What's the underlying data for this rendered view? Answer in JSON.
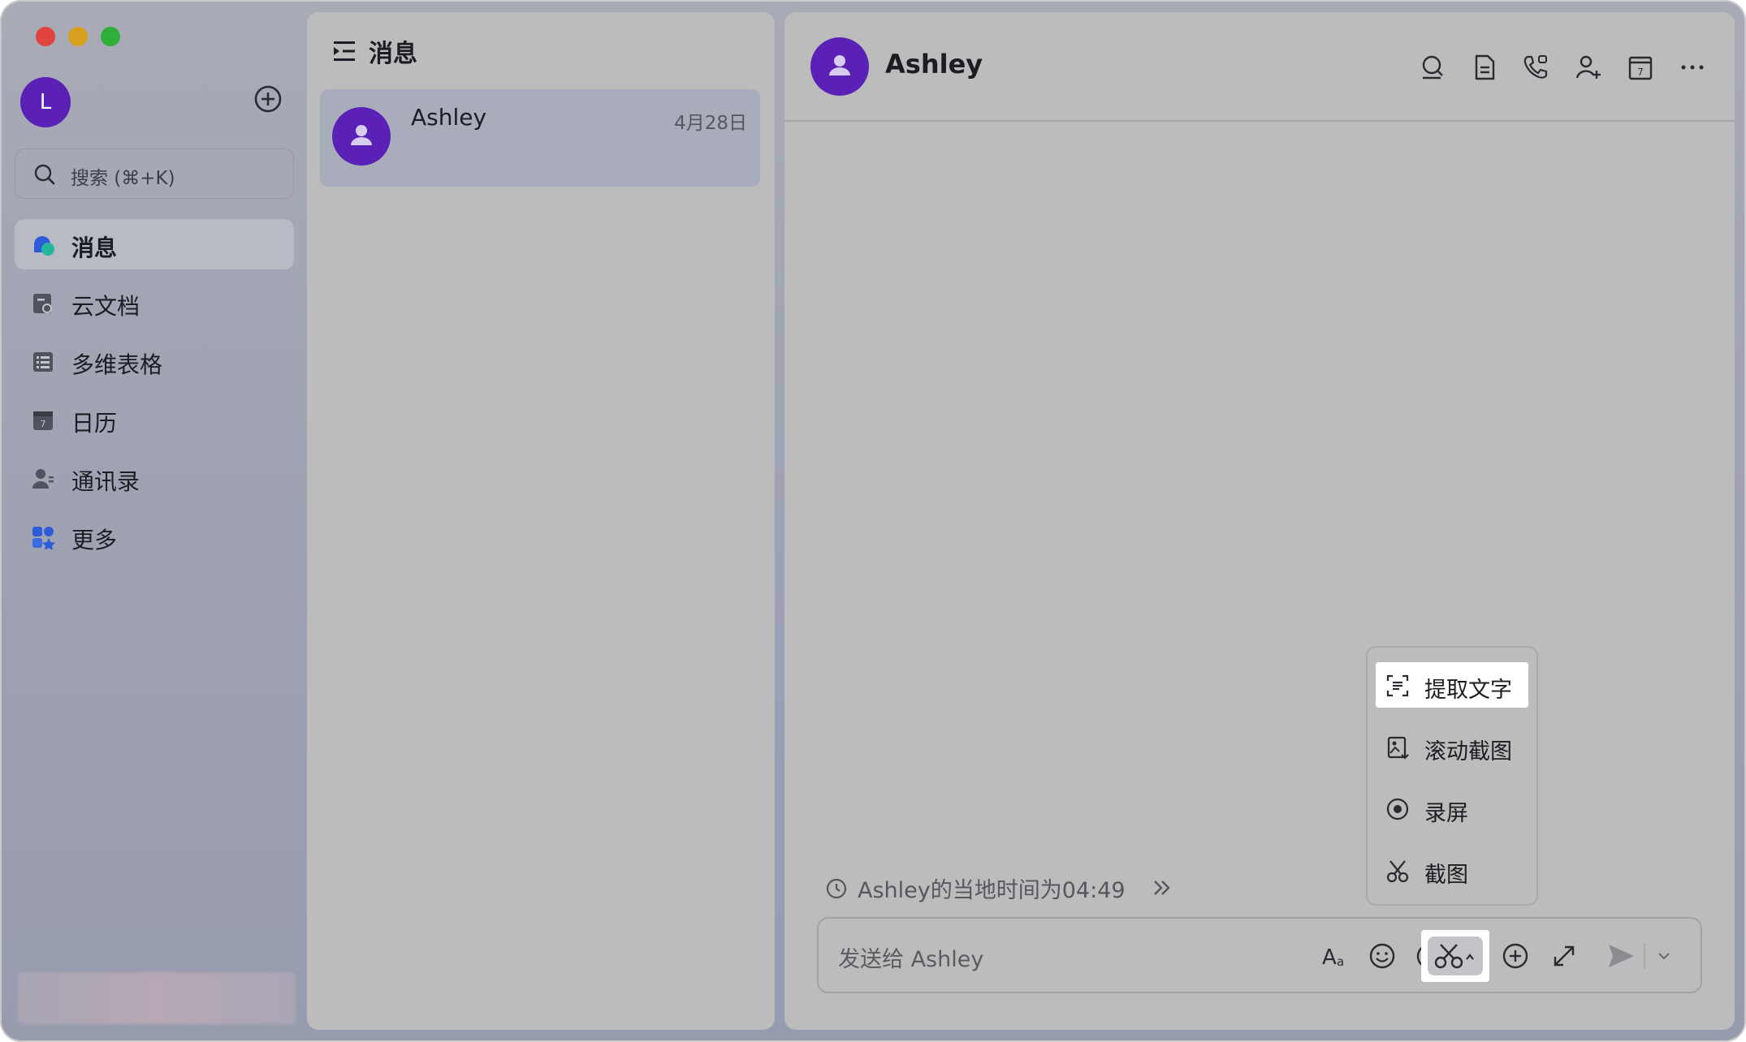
{
  "sidebar": {
    "user_initial": "L",
    "search": {
      "placeholder": "搜索 (⌘+K)"
    },
    "items": [
      {
        "label": "消息",
        "icon": "messages-icon",
        "active": true
      },
      {
        "label": "云文档",
        "icon": "cloud-docs-icon"
      },
      {
        "label": "多维表格",
        "icon": "base-table-icon"
      },
      {
        "label": "日历",
        "icon": "calendar-icon"
      },
      {
        "label": "通讯录",
        "icon": "contacts-icon"
      },
      {
        "label": "更多",
        "icon": "more-apps-icon"
      }
    ]
  },
  "message_list": {
    "title": "消息",
    "chats": [
      {
        "name": "Ashley",
        "date": "4月28日"
      }
    ]
  },
  "conversation": {
    "name": "Ashley",
    "header_icons": [
      "search-icon",
      "document-icon",
      "call-icon",
      "add-member-icon",
      "calendar-icon",
      "more-icon"
    ],
    "local_time": "Ashley的当地时间为04:49",
    "composer": {
      "placeholder": "发送给 Ashley",
      "tools": [
        "text-format-icon",
        "emoji-icon",
        "mention-icon",
        "scissors-icon",
        "plus-icon",
        "expand-icon",
        "send-icon"
      ]
    }
  },
  "screenshot_menu": {
    "items": [
      {
        "label": "提取文字",
        "icon": "extract-text-icon",
        "highlighted": true
      },
      {
        "label": "滚动截图",
        "icon": "scroll-screenshot-icon"
      },
      {
        "label": "录屏",
        "icon": "record-screen-icon"
      },
      {
        "label": "截图",
        "icon": "scissors-icon"
      }
    ]
  },
  "colors": {
    "avatar": "#5b21b6",
    "sidebar_bg": "#9ea1b2",
    "pane_bg": "#bcbcbc",
    "highlight": "#ffffff"
  }
}
